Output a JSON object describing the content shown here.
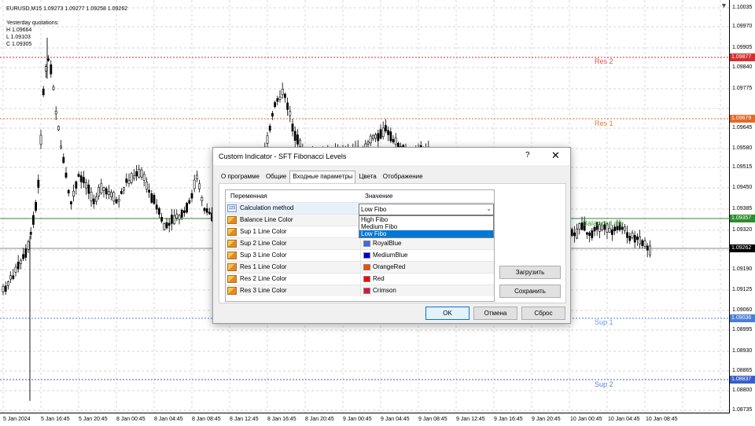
{
  "chart": {
    "symbol_line": "EURUSD,M15  1.09273 1.09277 1.09258 1.09262",
    "yesterday_title": "Yesterday quotations:",
    "yesterday_high": "H 1.09664",
    "yesterday_low": "L 1.09103",
    "yesterday_close": "C 1.09305",
    "price_axis": [
      "1.10035",
      "1.09970",
      "1.09905",
      "1.09840",
      "1.09775",
      "1.09645",
      "1.09580",
      "1.09515",
      "1.09450",
      "1.09385",
      "1.09320",
      "1.09190",
      "1.09125",
      "1.09060",
      "1.08995",
      "1.08930",
      "1.08865",
      "1.08800",
      "1.08735"
    ],
    "price_tags": [
      {
        "text": "1.09877",
        "color": "#d42f2f"
      },
      {
        "text": "1.09679",
        "color": "#e06a2a"
      },
      {
        "text": "1.09357",
        "color": "#2e8b2e"
      },
      {
        "text": "1.09262",
        "color": "#000000"
      },
      {
        "text": "1.09036",
        "color": "#4a7fd4"
      },
      {
        "text": "1.08837",
        "color": "#3a5fc8"
      }
    ],
    "levels": {
      "res2": "Res 2",
      "res1": "Res 1",
      "balance": "Balance Line",
      "sup1": "Sup 1",
      "sup2": "Sup 2"
    },
    "time_axis": [
      "5 Jan 2024",
      "5 Jan 16:45",
      "5 Jan 20:45",
      "8 Jan 00:45",
      "8 Jan 04:45",
      "8 Jan 08:45",
      "8 Jan 12:45",
      "8 Jan 16:45",
      "8 Jan 20:45",
      "9 Jan 00:45",
      "9 Jan 04:45",
      "9 Jan 08:45",
      "9 Jan 12:45",
      "9 Jan 16:45",
      "9 Jan 20:45",
      "10 Jan 00:45",
      "10 Jan 04:45",
      "10 Jan 08:45"
    ]
  },
  "dialog": {
    "title": "Custom Indicator - SFT Fibonacci Levels",
    "help": "?",
    "close": "✕",
    "tabs": [
      "О программе",
      "Общие",
      "Входные параметры",
      "Цвета",
      "Отображение"
    ],
    "active_tab": 2,
    "grid_headers": {
      "variable": "Переменная",
      "value": "Значение"
    },
    "rows": [
      {
        "name": "Calculation method",
        "value": "Low Fibo",
        "icon": "123-icon",
        "swatch": ""
      },
      {
        "name": "Balance Line Color",
        "value": "",
        "icon": "color-param-icon",
        "swatch": ""
      },
      {
        "name": "Sup 1 Line Color",
        "value": "",
        "icon": "color-param-icon",
        "swatch": ""
      },
      {
        "name": "Sup 2 Line Color",
        "value": "RoyalBlue",
        "icon": "color-param-icon",
        "swatch": "#4169e1"
      },
      {
        "name": "Sup 3 Line Color",
        "value": "MediumBlue",
        "icon": "color-param-icon",
        "swatch": "#0000cd"
      },
      {
        "name": "Res 1 Line Color",
        "value": "OrangeRed",
        "icon": "color-param-icon",
        "swatch": "#ff4500"
      },
      {
        "name": "Res 2 Line Color",
        "value": "Red",
        "icon": "color-param-icon",
        "swatch": "#ff0000"
      },
      {
        "name": "Res 3 Line Color",
        "value": "Crimson",
        "icon": "color-param-icon",
        "swatch": "#dc143c"
      }
    ],
    "combo_value": "Low Fibo",
    "combo_options": [
      "High Fibo",
      "Medium Fibo",
      "Low Fibo"
    ],
    "combo_selected": 2,
    "load_button": "Загрузить",
    "save_button": "Сохранить",
    "ok_button": "OK",
    "cancel_button": "Отмена",
    "reset_button": "Сброс"
  }
}
